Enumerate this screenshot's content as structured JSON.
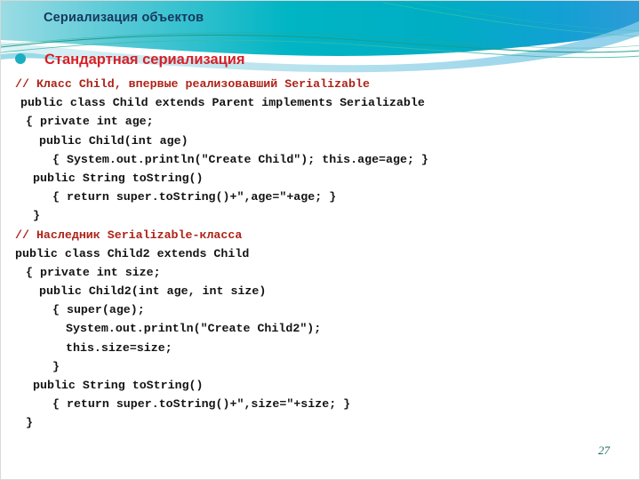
{
  "slide": {
    "title": "Сериализация объектов",
    "section_heading": "Стандартная сериализация",
    "page_number": "27",
    "bullet_icon": "bullet-dot-icon",
    "colors": {
      "title_text": "#17365D",
      "heading_red": "#D81F26",
      "comment_red": "#AE2318",
      "code_text": "#131313",
      "bullet_teal": "#1BAEC0",
      "banner_cyan": "#00B0C8",
      "banner_blue": "#2196D6",
      "banner_light": "#9FD9E8",
      "page_number_teal": "#1F6D63",
      "background": "#FFFFFF"
    }
  },
  "code": {
    "lines": [
      {
        "indent": 16,
        "text": "// Класс Child, впервые реализовавший Serializable",
        "style": "comment"
      },
      {
        "indent": 22,
        "text": "public class Child extends Parent implements Serializable",
        "style": "normal"
      },
      {
        "indent": 28,
        "text": "{ private int age;",
        "style": "normal"
      },
      {
        "indent": 43,
        "text": "public Child(int age)",
        "style": "normal"
      },
      {
        "indent": 58,
        "text": "{ System.out.println(\"Create Child\"); this.age=age; }",
        "style": "normal"
      },
      {
        "indent": 36,
        "text": "public String toString()",
        "style": "normal"
      },
      {
        "indent": 58,
        "text": "{ return super.toString()+\",age=\"+age; }",
        "style": "normal"
      },
      {
        "indent": 36,
        "text": "}",
        "style": "normal"
      },
      {
        "indent": 16,
        "text": "// Наследник Serializable-класса",
        "style": "comment"
      },
      {
        "indent": 16,
        "text": "public class Child2 extends Child",
        "style": "normal"
      },
      {
        "indent": 28,
        "text": "{ private int size;",
        "style": "normal"
      },
      {
        "indent": 43,
        "text": "public Child2(int age, int size)",
        "style": "normal"
      },
      {
        "indent": 58,
        "text": "{ super(age);",
        "style": "normal"
      },
      {
        "indent": 73,
        "text": "System.out.println(\"Create Child2\");",
        "style": "normal"
      },
      {
        "indent": 73,
        "text": "this.size=size;",
        "style": "normal"
      },
      {
        "indent": 58,
        "text": "}",
        "style": "normal"
      },
      {
        "indent": 36,
        "text": "public String toString()",
        "style": "normal"
      },
      {
        "indent": 58,
        "text": "{ return super.toString()+\",size=\"+size; }",
        "style": "normal"
      },
      {
        "indent": 28,
        "text": "}",
        "style": "normal"
      }
    ]
  }
}
